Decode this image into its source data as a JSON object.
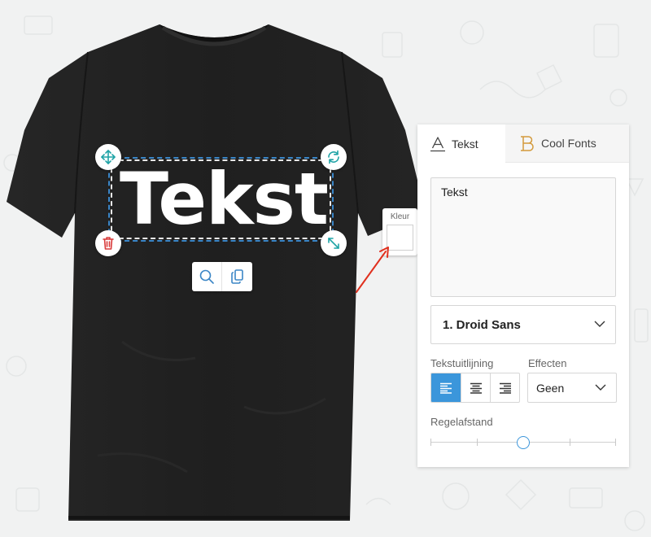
{
  "canvas": {
    "design_text": "Tekst",
    "shirt_color": "#1b1b1b",
    "selection_color": "#3a86c8",
    "handles": {
      "move_icon": "move-arrows-icon",
      "rotate_icon": "rotate-icon",
      "delete_icon": "trash-icon",
      "resize_icon": "resize-diagonal-icon"
    },
    "toolbar": {
      "zoom_icon": "magnifier-icon",
      "duplicate_icon": "duplicate-icon"
    },
    "color_picker": {
      "label": "Kleur",
      "value": "#ffffff"
    }
  },
  "panel": {
    "tabs": [
      {
        "label": "Tekst",
        "icon": "text-a-icon",
        "active": true
      },
      {
        "label": "Cool Fonts",
        "icon": "cool-fonts-b-icon",
        "active": false
      }
    ],
    "text_input": {
      "value": "Tekst"
    },
    "font_select": {
      "value": "1. Droid Sans"
    },
    "alignment": {
      "label": "Tekstuitlijning",
      "options": [
        "left",
        "center",
        "right"
      ],
      "selected": "left"
    },
    "effects": {
      "label": "Effecten",
      "value": "Geen"
    },
    "line_spacing": {
      "label": "Regelafstand",
      "value_fraction": 0.5
    },
    "accent_color": "#3b96db"
  }
}
